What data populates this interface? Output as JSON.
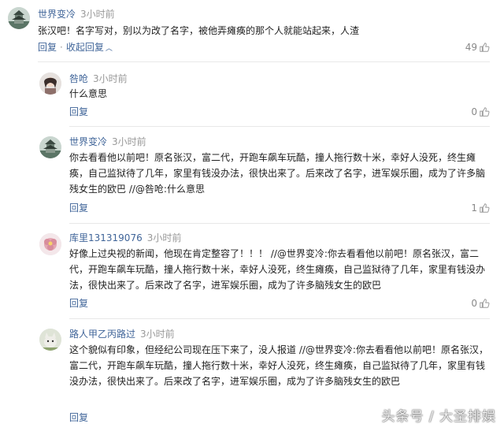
{
  "comments": [
    {
      "author": "世界变冷",
      "time": "3小时前",
      "text": "张汉吧！名字写对，别以为改了名字，被他弄瘫痪的那个人就能站起来，人渣",
      "reply_label": "回复",
      "collapse_label": "收起回复",
      "likes": "49",
      "avatar": "pagoda-avatar"
    },
    {
      "author": "咎呛",
      "time": "3小时前",
      "text": "什么意思",
      "reply_label": "回复",
      "likes": "0",
      "avatar": "girl-avatar"
    },
    {
      "author": "世界变冷",
      "time": "3小时前",
      "text": "你去看看他以前吧！原名张汉，富二代，开跑车飙车玩酷，撞人拖行数十米，幸好人没死，终生瘫痪，自己监狱待了几年，家里有钱没办法，很快出来了。后来改了名字，进军娱乐圈，成为了许多脑残女生的欧巴 //@咎呛:什么意思",
      "reply_label": "回复",
      "likes": "1",
      "avatar": "pagoda-avatar"
    },
    {
      "author": "库里131319076",
      "time": "3小时前",
      "text": "好像上过央视的新闻，他现在肯定整容了！！！ //@世界变冷:你去看看他以前吧！原名张汉，富二代，开跑车飙车玩酷，撞人拖行数十米，幸好人没死，终生瘫痪，自己监狱待了几年，家里有钱没办法，很快出来了。后来改了名字，进军娱乐圈，成为了许多脑残女生的欧巴",
      "reply_label": "回复",
      "likes": "0",
      "avatar": "flower-avatar"
    },
    {
      "author": "路人甲乙丙路过",
      "time": "3小时前",
      "text": "这个貌似有印象，但经纪公司现在压下来了，没人报道 //@世界变冷:你去看看他以前吧！原名张汉，富二代，开跑车飙车玩酷，撞人拖行数十米，幸好人没死，终生瘫痪，自己监狱待了几年，家里有钱没办法，很快出来了。后来改了名字，进军娱乐圈，成为了许多脑残女生的欧巴",
      "reply_label": "回复",
      "avatar": "cat-avatar"
    }
  ],
  "watermark": "头条号 / 大圣排娱",
  "icons": {
    "like": "thumbs-up-icon",
    "collapse": "chevron-up-icon"
  },
  "colors": {
    "link": "#406599",
    "meta": "#999999",
    "text": "#222222"
  }
}
